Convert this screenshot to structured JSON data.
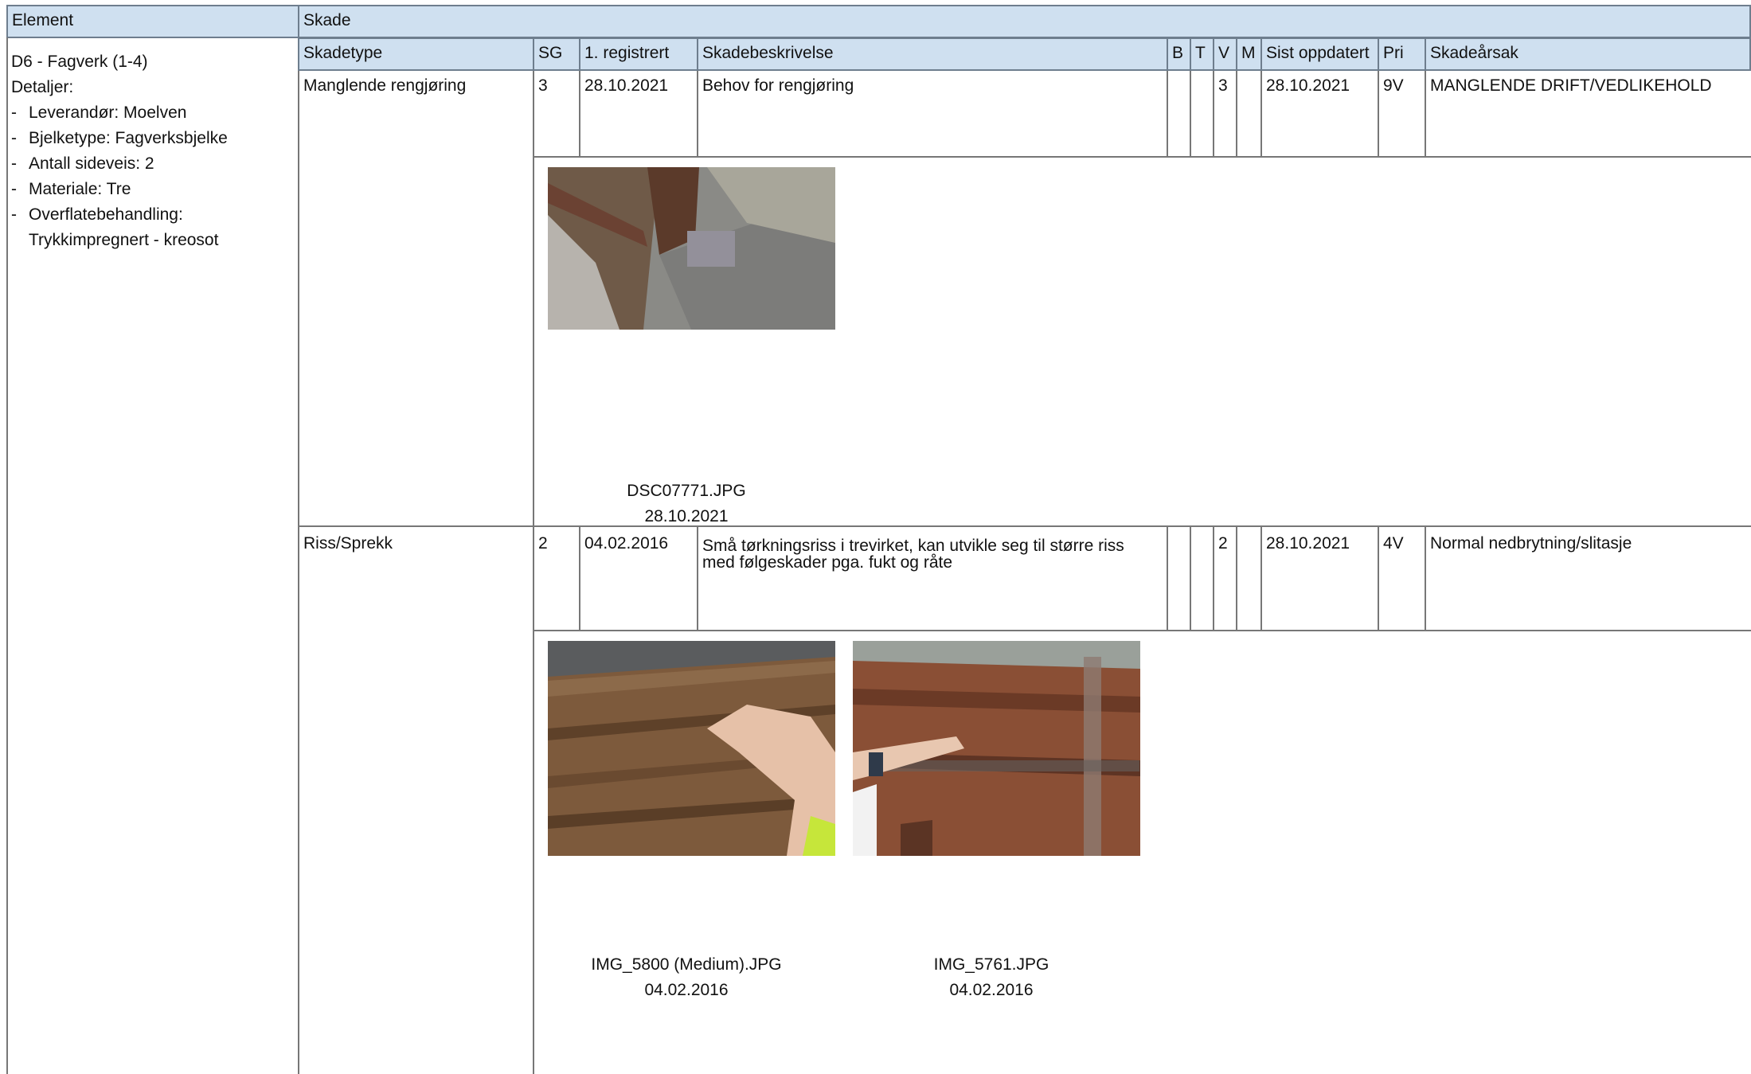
{
  "header": {
    "element": "Element",
    "skade": "Skade"
  },
  "columns": {
    "skadetype": "Skadetype",
    "sg": "SG",
    "registrert": "1. registrert",
    "beskrivelse": "Skadebeskrivelse",
    "b": "B",
    "t": "T",
    "v": "V",
    "m": "M",
    "oppdatert": "Sist oppdatert",
    "pri": "Pri",
    "arsak": "Skadeårsak"
  },
  "element": {
    "title": "D6 - Fagverk (1-4)",
    "details_label": "Detaljer:",
    "details": [
      "Leverandør: Moelven",
      "Bjelketype: Fagverksbjelke",
      "Antall sideveis: 2",
      "Materiale: Tre",
      "Overflatebehandling:"
    ],
    "details_cont": "Trykkimpregnert - kreosot"
  },
  "damages": [
    {
      "skadetype": "Manglende rengjøring",
      "sg": "3",
      "registrert": "28.10.2021",
      "beskrivelse": "Behov for rengjøring",
      "b": "",
      "t": "",
      "v": "3",
      "m": "",
      "oppdatert": "28.10.2021",
      "pri": "9V",
      "arsak": "MANGLENDE DRIFT/VEDLIKEHOLD",
      "photos": [
        {
          "filename": "DSC07771.JPG",
          "date": "28.10.2021"
        }
      ]
    },
    {
      "skadetype": "Riss/Sprekk",
      "sg": "2",
      "registrert": "04.02.2016",
      "beskrivelse": "Små tørkningsriss i trevirket, kan utvikle seg til større riss med følgeskader pga. fukt og råte",
      "b": "",
      "t": "",
      "v": "2",
      "m": "",
      "oppdatert": "28.10.2021",
      "pri": "4V",
      "arsak": "Normal nedbrytning/slitasje",
      "photos": [
        {
          "filename": "IMG_5800 (Medium).JPG",
          "date": "04.02.2016"
        },
        {
          "filename": "IMG_5761.JPG",
          "date": "04.02.2016"
        }
      ]
    }
  ]
}
